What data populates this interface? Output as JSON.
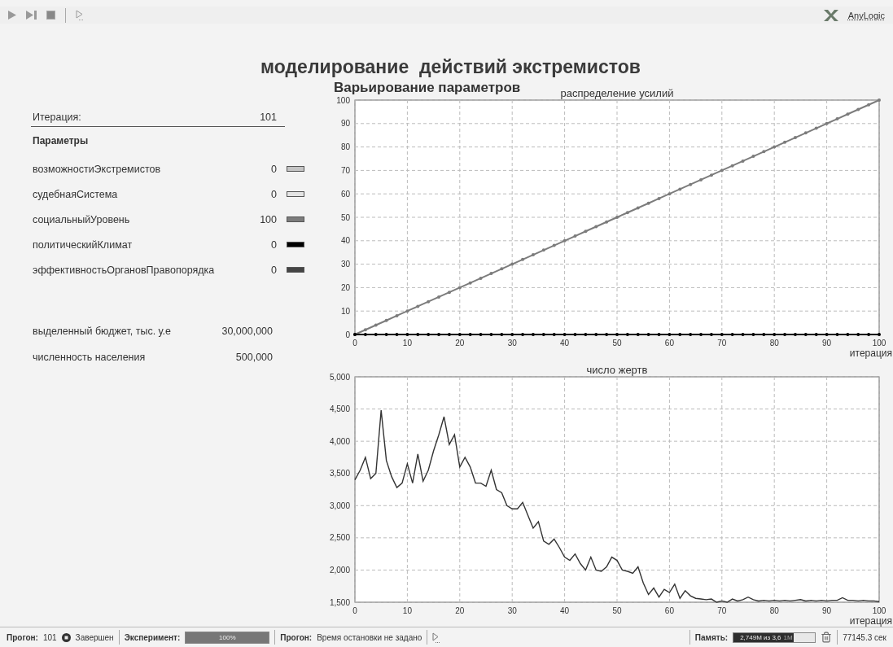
{
  "toolbar": {
    "logo": "AnyLogic"
  },
  "title": "моделирование  действий экстремистов",
  "subtitle": "Варьирование параметров",
  "iteration": {
    "label": "Итерация:",
    "value": "101"
  },
  "parameters": {
    "heading": "Параметры",
    "items": [
      {
        "name": "возможностиЭкстремистов",
        "value": "0",
        "color": "#c4c4c4"
      },
      {
        "name": "судебнаяСистема",
        "value": "0",
        "color": "#e4e4e4"
      },
      {
        "name": "социальныйУровень",
        "value": "100",
        "color": "#7c7c7c"
      },
      {
        "name": "политическийКлимат",
        "value": "0",
        "color": "#000000"
      },
      {
        "name": "эффективностьОргановПравопорядка",
        "value": "0",
        "color": "#444444"
      }
    ]
  },
  "totals": [
    {
      "label": "выделенный бюджет, тыс. у.е",
      "value": "30,000,000"
    },
    {
      "label": "численность населения",
      "value": "500,000"
    }
  ],
  "charts": [
    {
      "kind": "markers",
      "chart_data": {
        "type": "line",
        "title": "распределение усилий",
        "xlabel": "итерация",
        "xlim": [
          0,
          100
        ],
        "ylim": [
          0,
          100
        ],
        "xticks": [
          0,
          10,
          20,
          30,
          40,
          50,
          60,
          70,
          80,
          90,
          100
        ],
        "yticks": [
          0,
          10,
          20,
          30,
          40,
          50,
          60,
          70,
          80,
          90,
          100
        ],
        "x": [
          0,
          2,
          4,
          6,
          8,
          10,
          12,
          14,
          16,
          18,
          20,
          22,
          24,
          26,
          28,
          30,
          32,
          34,
          36,
          38,
          40,
          42,
          44,
          46,
          48,
          50,
          52,
          54,
          56,
          58,
          60,
          62,
          64,
          66,
          68,
          70,
          72,
          74,
          76,
          78,
          80,
          82,
          84,
          86,
          88,
          90,
          92,
          94,
          96,
          98,
          100
        ],
        "series": [
          {
            "color": "#7c7c7c",
            "values": [
              0,
              2,
              4,
              6,
              8,
              10,
              12,
              14,
              16,
              18,
              20,
              22,
              24,
              26,
              28,
              30,
              32,
              34,
              36,
              38,
              40,
              42,
              44,
              46,
              48,
              50,
              52,
              54,
              56,
              58,
              60,
              62,
              64,
              66,
              68,
              70,
              72,
              74,
              76,
              78,
              80,
              82,
              84,
              86,
              88,
              90,
              92,
              94,
              96,
              98,
              100
            ]
          },
          {
            "color": "#000000",
            "values": [
              0,
              0,
              0,
              0,
              0,
              0,
              0,
              0,
              0,
              0,
              0,
              0,
              0,
              0,
              0,
              0,
              0,
              0,
              0,
              0,
              0,
              0,
              0,
              0,
              0,
              0,
              0,
              0,
              0,
              0,
              0,
              0,
              0,
              0,
              0,
              0,
              0,
              0,
              0,
              0,
              0,
              0,
              0,
              0,
              0,
              0,
              0,
              0,
              0,
              0,
              0
            ]
          }
        ],
        "grid": true
      }
    },
    {
      "kind": "plain",
      "chart_data": {
        "type": "line",
        "title": "число жертв",
        "xlabel": "итерация",
        "xlim": [
          0,
          100
        ],
        "ylim": [
          1500,
          5000
        ],
        "xticks": [
          0,
          10,
          20,
          30,
          40,
          50,
          60,
          70,
          80,
          90,
          100
        ],
        "yticks": [
          {
            "value": 1500,
            "label": "1,500"
          },
          {
            "value": 2000,
            "label": "2,000"
          },
          {
            "value": 2500,
            "label": "2,500"
          },
          {
            "value": 3000,
            "label": "3,000"
          },
          {
            "value": 3500,
            "label": "3,500"
          },
          {
            "value": 4000,
            "label": "4,000"
          },
          {
            "value": 4500,
            "label": "4,500"
          },
          {
            "value": 5000,
            "label": "5,000"
          }
        ],
        "x": [
          0,
          1,
          2,
          3,
          4,
          5,
          6,
          7,
          8,
          9,
          10,
          11,
          12,
          13,
          14,
          15,
          16,
          17,
          18,
          19,
          20,
          21,
          22,
          23,
          24,
          25,
          26,
          27,
          28,
          29,
          30,
          31,
          32,
          33,
          34,
          35,
          36,
          37,
          38,
          39,
          40,
          41,
          42,
          43,
          44,
          45,
          46,
          47,
          48,
          49,
          50,
          51,
          52,
          53,
          54,
          55,
          56,
          57,
          58,
          59,
          60,
          61,
          62,
          63,
          64,
          65,
          66,
          67,
          68,
          69,
          70,
          71,
          72,
          73,
          74,
          75,
          76,
          77,
          78,
          79,
          80,
          81,
          82,
          83,
          84,
          85,
          86,
          87,
          88,
          89,
          90,
          91,
          92,
          93,
          94,
          95,
          96,
          97,
          98,
          99,
          100
        ],
        "series": [
          {
            "color": "#333333",
            "values": [
              3400,
              3550,
              3750,
              3420,
              3500,
              4480,
              3700,
              3450,
              3280,
              3350,
              3650,
              3350,
              3800,
              3380,
              3550,
              3850,
              4100,
              4380,
              3950,
              4100,
              3600,
              3750,
              3600,
              3350,
              3350,
              3300,
              3550,
              3250,
              3200,
              3000,
              2950,
              2950,
              3050,
              2850,
              2650,
              2750,
              2450,
              2400,
              2480,
              2350,
              2200,
              2150,
              2250,
              2100,
              2000,
              2200,
              2000,
              1980,
              2050,
              2200,
              2150,
              2000,
              1980,
              1950,
              2050,
              1800,
              1620,
              1720,
              1580,
              1700,
              1650,
              1780,
              1560,
              1680,
              1600,
              1560,
              1550,
              1540,
              1550,
              1500,
              1520,
              1500,
              1550,
              1520,
              1540,
              1580,
              1540,
              1520,
              1530,
              1520,
              1530,
              1520,
              1530,
              1520,
              1530,
              1540,
              1520,
              1530,
              1520,
              1530,
              1520,
              1530,
              1530,
              1570,
              1530,
              1530,
              1520,
              1530,
              1520,
              1520,
              1510
            ]
          }
        ],
        "grid": true
      }
    }
  ],
  "status": {
    "run_label": "Прогон:",
    "run_value": "101",
    "run_state": "Завершен",
    "experiment_label": "Эксперимент:",
    "experiment_progress": {
      "text": "100%",
      "level": 1
    },
    "stop_label": "Прогон:",
    "stop_text": "Время остановки не задано",
    "memory_label": "Память:",
    "memory": {
      "used": "2,749M из 3,6",
      "rest": "1M",
      "level": 0.74
    },
    "time": "77145.3 сек"
  }
}
